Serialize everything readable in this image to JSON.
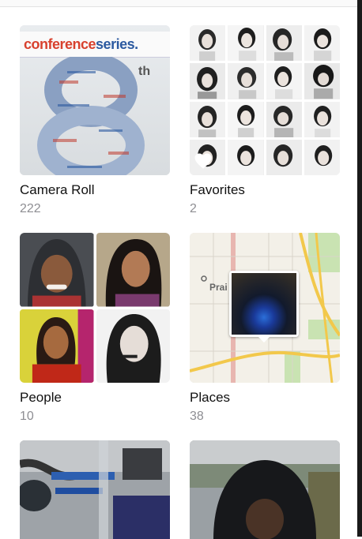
{
  "albums": [
    {
      "title": "Camera Roll",
      "count": "222",
      "thumb_text": {
        "banner_pre": "conference",
        "banner_post": "series.",
        "suffix": "th"
      }
    },
    {
      "title": "Favorites",
      "count": "2"
    },
    {
      "title": "People",
      "count": "10"
    },
    {
      "title": "Places",
      "count": "38",
      "map_label": "Prai"
    },
    {
      "title": "",
      "count": ""
    },
    {
      "title": "",
      "count": ""
    }
  ]
}
